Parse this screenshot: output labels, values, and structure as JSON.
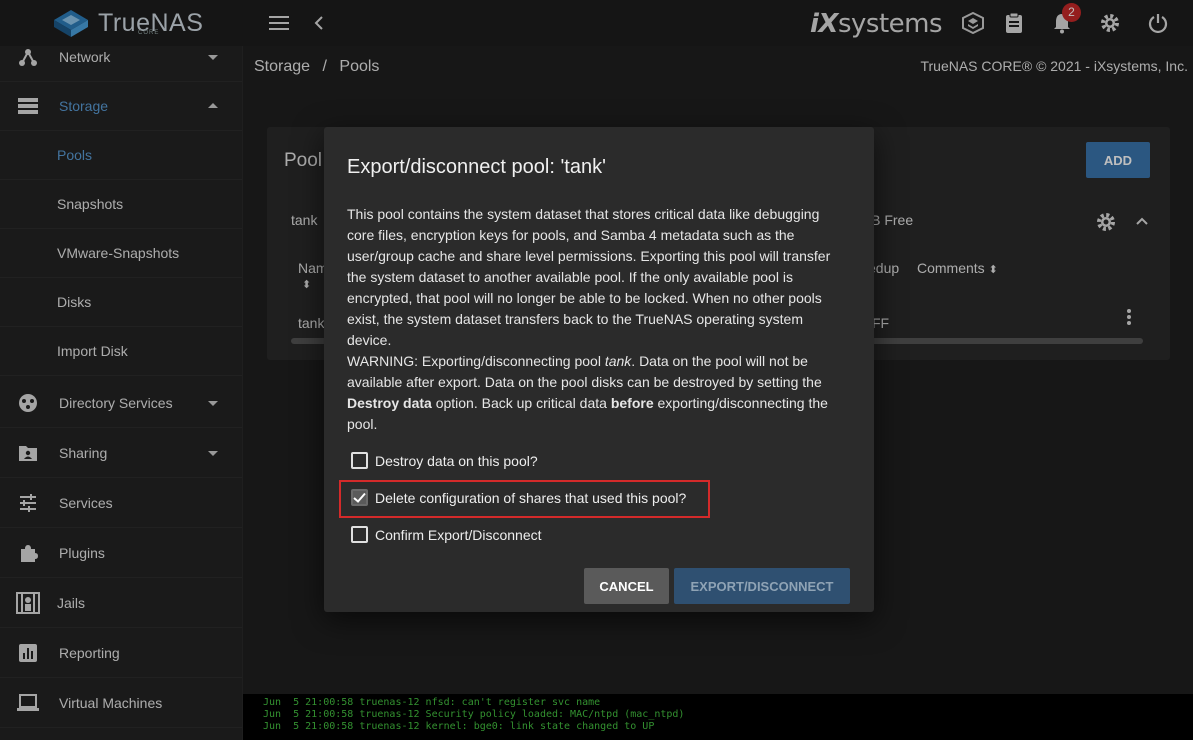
{
  "app": {
    "name": "TrueNAS",
    "sub": "CORE",
    "vendor_prefix": "iX",
    "vendor_suffix": "systems"
  },
  "topbar": {
    "notifications_count": "2"
  },
  "sidebar": {
    "items": [
      {
        "label": "Network",
        "icon": "network-icon"
      },
      {
        "label": "Storage",
        "icon": "storage-icon",
        "expanded": true
      },
      {
        "label": "Directory Services",
        "icon": "directory-services-icon"
      },
      {
        "label": "Sharing",
        "icon": "sharing-icon"
      },
      {
        "label": "Services",
        "icon": "services-icon"
      },
      {
        "label": "Plugins",
        "icon": "plugins-icon"
      },
      {
        "label": "Jails",
        "icon": "jails-icon"
      },
      {
        "label": "Reporting",
        "icon": "reporting-icon"
      },
      {
        "label": "Virtual Machines",
        "icon": "virtual-machines-icon"
      }
    ],
    "storage_sub": [
      {
        "label": "Pools",
        "active": true
      },
      {
        "label": "Snapshots"
      },
      {
        "label": "VMware-Snapshots"
      },
      {
        "label": "Disks"
      },
      {
        "label": "Import Disk"
      }
    ]
  },
  "header": {
    "breadcrumb_1": "Storage",
    "breadcrumb_sep": "/",
    "breadcrumb_2": "Pools",
    "copyright": "TrueNAS CORE® © 2021 - iXsystems, Inc."
  },
  "pools_card": {
    "title": "Pool",
    "add_label": "ADD",
    "pool_name": "tank",
    "free_fragment": "iB Free",
    "col_name": "Nam",
    "col_dedup": "edup",
    "col_comments": "Comments",
    "row_name": "tank",
    "row_dedup": "FF"
  },
  "dialog": {
    "title": "Export/disconnect pool: 'tank'",
    "body_p1": "This pool contains the system dataset that stores critical data like debugging core files, encryption keys for pools, and Samba 4 metadata such as the user/group cache and share level permissions. Exporting this pool will transfer the system dataset to another available pool. If the only available pool is encrypted, that pool will no longer be able to be locked. When no other pools exist, the system dataset transfers back to the TrueNAS operating system device.",
    "warn_a": "WARNING: Exporting/disconnecting pool ",
    "warn_pool": "tank",
    "warn_b": ". Data on the pool will not be available after export. Data on the pool disks can be destroyed by setting the ",
    "warn_bold1": "Destroy data",
    "warn_c": " option. Back up critical data ",
    "warn_bold2": "before",
    "warn_d": " exporting/disconnecting the pool.",
    "cb_destroy": "Destroy data on this pool?",
    "cb_delete_shares": "Delete configuration of shares that used this pool?",
    "cb_confirm": "Confirm Export/Disconnect",
    "cancel_label": "CANCEL",
    "export_label": "EXPORT/DISCONNECT"
  },
  "console": {
    "lines": [
      "Jun  5 21:00:58 truenas-12 nfsd: can't register svc name",
      "Jun  5 21:00:58 truenas-12 Security policy loaded: MAC/ntpd (mac_ntpd)",
      "Jun  5 21:00:58 truenas-12 kernel: bge0: link state changed to UP"
    ]
  }
}
